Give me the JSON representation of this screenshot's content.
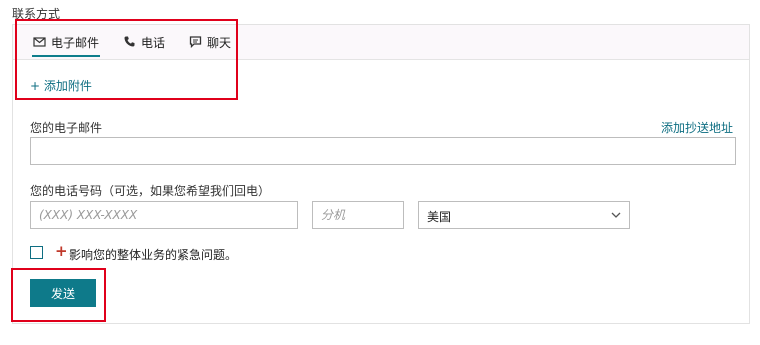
{
  "section_title": "联系方式",
  "tabs": [
    {
      "label": "电子邮件",
      "icon": "mail-icon",
      "active": true
    },
    {
      "label": "电话",
      "icon": "phone-icon",
      "active": false
    },
    {
      "label": "聊天",
      "icon": "chat-icon",
      "active": false
    }
  ],
  "add_attachment": "+ 添加附件",
  "email": {
    "label": "您的电子邮件",
    "cc_link": "添加抄送地址",
    "value": ""
  },
  "phone": {
    "label": "您的电话号码（可选，如果您希望我们回电）",
    "number_placeholder": "(XXX) XXX-XXXX",
    "extension_placeholder": "分机",
    "country": "美国"
  },
  "urgent": {
    "marker": "+",
    "label": "影响您的整体业务的紧急问题。",
    "checked": false
  },
  "send_button": "发送",
  "colors": {
    "accent": "#0e7a8a",
    "link": "#0e6e82",
    "highlight": "#e0001b",
    "urgent": "#c0392b"
  }
}
